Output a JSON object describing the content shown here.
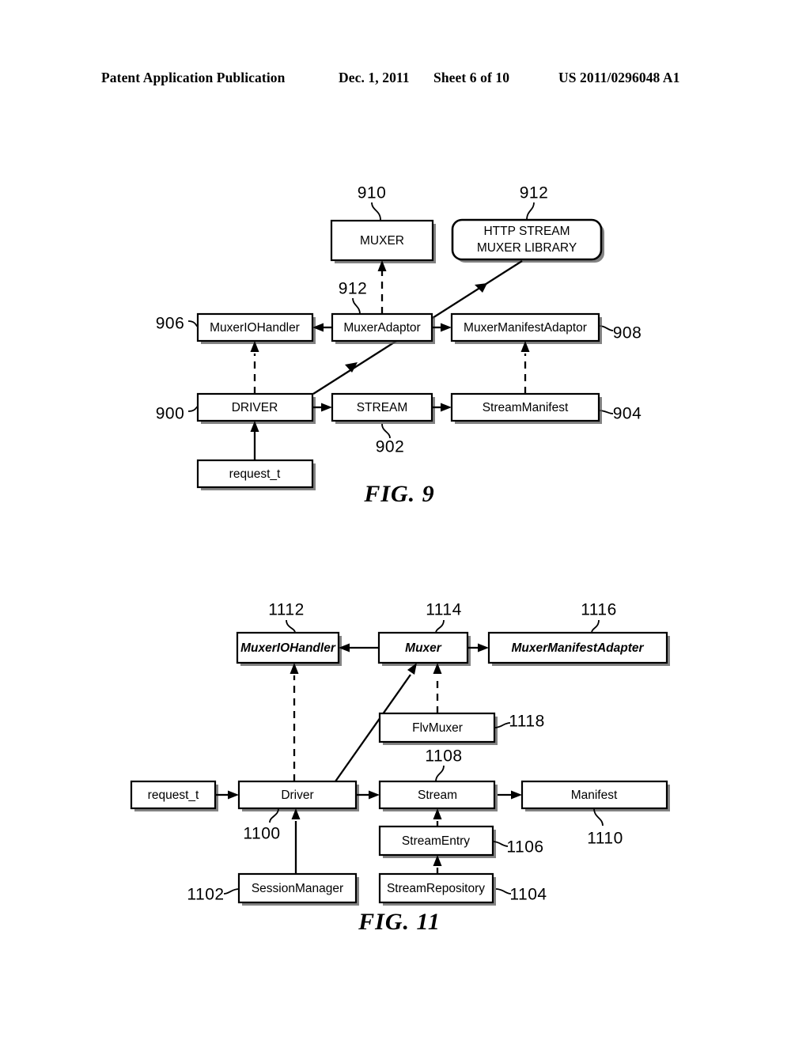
{
  "header": {
    "title": "Patent Application Publication",
    "date": "Dec. 1, 2011",
    "sheet": "Sheet 6 of 10",
    "publication_number": "US 2011/0296048 A1"
  },
  "figures": [
    {
      "caption": "FIG. 9",
      "boxes": {
        "muxer": "MUXER",
        "http_stream_muxer_library_line1": "HTTP STREAM",
        "http_stream_muxer_library_line2": "MUXER LIBRARY",
        "muxer_io_handler": "MuxerIOHandler",
        "muxer_adaptor": "MuxerAdaptor",
        "muxer_manifest_adaptor": "MuxerManifestAdaptor",
        "driver": "DRIVER",
        "stream": "STREAM",
        "stream_manifest": "StreamManifest",
        "request_t": "request_t"
      },
      "refs": {
        "muxer": "910",
        "http_stream_muxer_library": "912",
        "muxer_adaptor": "912",
        "muxer_io_handler": "906",
        "muxer_manifest_adaptor": "908",
        "driver": "900",
        "stream": "902",
        "stream_manifest": "904"
      }
    },
    {
      "caption": "FIG. 11",
      "boxes": {
        "muxer_io_handler": "MuxerIOHandler",
        "muxer": "Muxer",
        "muxer_manifest_adapter": "MuxerManifestAdapter",
        "flv_muxer": "FlvMuxer",
        "request_t": "request_t",
        "driver": "Driver",
        "stream": "Stream",
        "manifest": "Manifest",
        "stream_entry": "StreamEntry",
        "stream_repository": "StreamRepository",
        "session_manager": "SessionManager"
      },
      "refs": {
        "muxer_io_handler": "1112",
        "muxer": "1114",
        "muxer_manifest_adapter": "1116",
        "flv_muxer": "1118",
        "stream": "1108",
        "driver": "1100",
        "manifest": "1110",
        "stream_entry": "1106",
        "stream_repository": "1104",
        "session_manager": "1102"
      }
    }
  ],
  "colors": {
    "ink": "#000000",
    "paper": "#ffffff",
    "shadow": "#5a5a5a"
  }
}
